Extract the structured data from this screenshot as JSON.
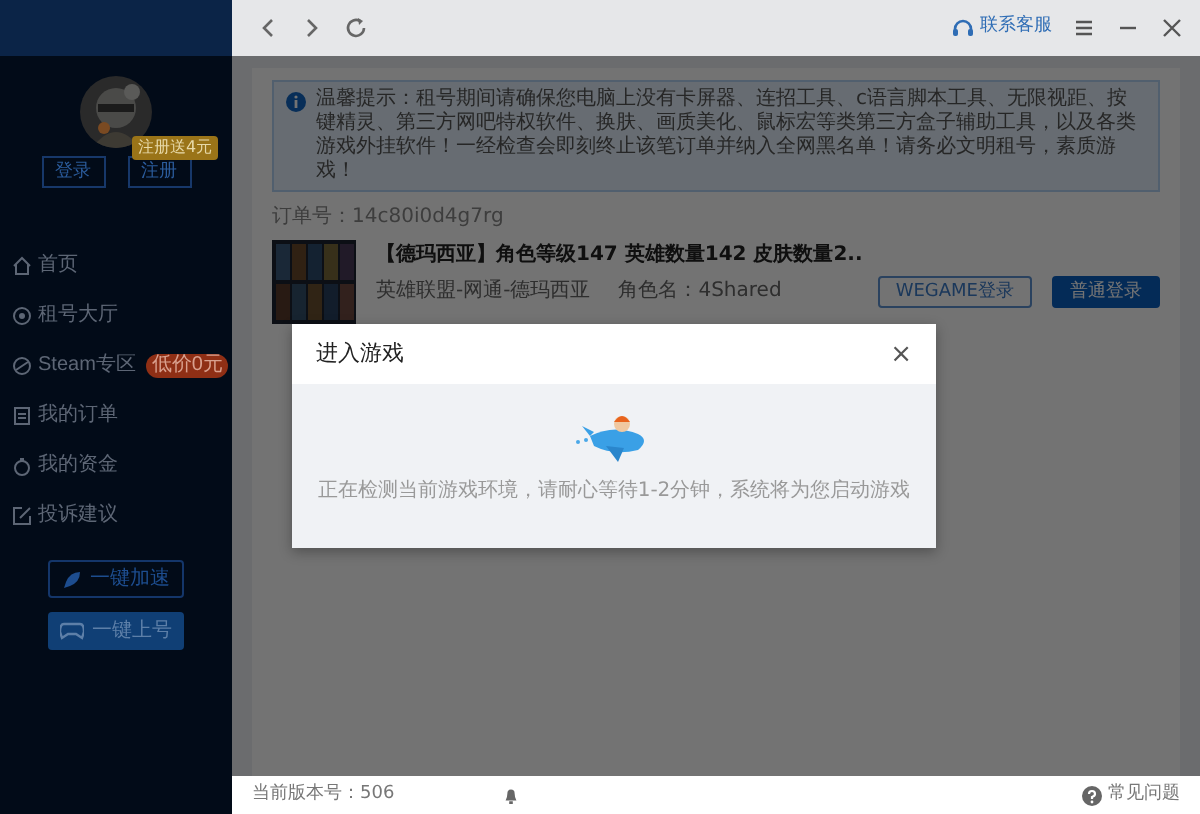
{
  "topbar": {
    "support": "联系客服"
  },
  "sidebar": {
    "badge": "注册送4元",
    "auth_buttons": [
      "登录",
      "注册"
    ],
    "menu": [
      {
        "label": "首页"
      },
      {
        "label": "租号大厅"
      },
      {
        "label": "Steam专区",
        "badge": "低价0元"
      },
      {
        "label": "我的订单"
      },
      {
        "label": "我的资金"
      },
      {
        "label": "投诉建议"
      }
    ],
    "action_buttons": [
      {
        "label": "一键加速",
        "kind": "outline"
      },
      {
        "label": "一键上号",
        "kind": "filled"
      }
    ]
  },
  "notice": {
    "text": "温馨提示：租号期间请确保您电脑上没有卡屏器、连招工具、c语言脚本工具、无限视距、按键精灵、第三方网吧特权软件、换肤、画质美化、鼠标宏等类第三方盒子辅助工具，以及各类游戏外挂软件！一经检查会即刻终止该笔订单并纳入全网黑名单！请务必文明租号，素质游戏！"
  },
  "order": {
    "number": "订单号：14c80i0d4g7rg"
  },
  "listing": {
    "title": "【德玛西亚】角色等级147 英雄数量142 皮肤数量2..",
    "server": "英雄联盟-网通-德玛西亚",
    "role": "角色名：4Shared",
    "buttons": [
      {
        "label": "WEGAME登录",
        "kind": "outline"
      },
      {
        "label": "普通登录",
        "kind": "primary"
      }
    ]
  },
  "dialog": {
    "title": "进入游戏",
    "close": "×",
    "message": "正在检测当前游戏环境，请耐心等待1-2分钟，系统将为您启动游戏"
  },
  "status_bar": {
    "version": "当前版本号：506",
    "help": "常见问题"
  }
}
